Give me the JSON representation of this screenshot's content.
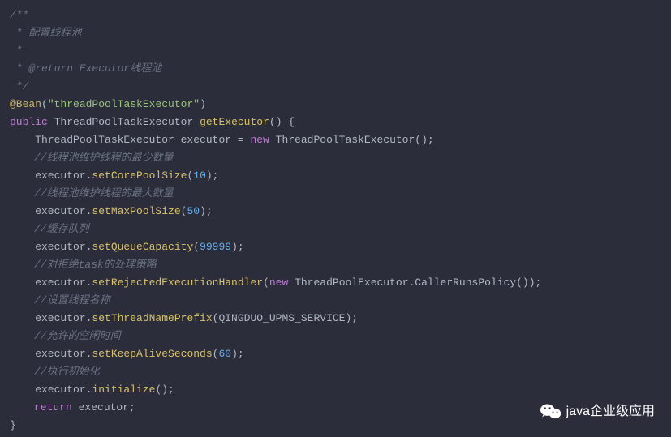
{
  "code": {
    "c1": "/**",
    "c2": " * 配置线程池",
    "c3": " *",
    "c4": " * @return Executor线程池",
    "c5": " */",
    "anno": "@Bean",
    "annoVal": "\"threadPoolTaskExecutor\"",
    "kwPublic": "public",
    "typeExec": "ThreadPoolTaskExecutor",
    "mGetExec": "getExecutor",
    "sigEnd": "() {",
    "declExec": "    ThreadPoolTaskExecutor executor = ",
    "kwNew": "new",
    "ctor": " ThreadPoolTaskExecutor();",
    "cmMin": "//线程池维护线程的最少数量",
    "preDot": "    executor.",
    "mCoreSize": "setCorePoolSize",
    "nCore": "10",
    "cmMax": "//线程池维护线程的最大数量",
    "mMaxSize": "setMaxPoolSize",
    "nMax": "50",
    "cmQueue": "//缓存队列",
    "mQueueCap": "setQueueCapacity",
    "nQueue": "99999",
    "cmReject": "//对拒绝task的处理策略",
    "mRejHandler": "setRejectedExecutionHandler",
    "rejCtor": " ThreadPoolExecutor.CallerRunsPolicy());",
    "cmName": "//设置线程名称",
    "mPrefix": "setThreadNamePrefix",
    "prefixArg": "(QINGDUO_UPMS_SERVICE);",
    "cmIdle": "//允许的空闲时间",
    "mKeepAlive": "setKeepAliveSeconds",
    "nKeep": "60",
    "cmInit": "//执行初始化",
    "mInit": "initialize",
    "initArgs": "();",
    "kwReturn": "return",
    "retTail": " executor;",
    "closeBrace": "}",
    "parenOpen": "(",
    "parenCloseStmt": ");"
  },
  "watermark": {
    "text": "java企业级应用"
  }
}
